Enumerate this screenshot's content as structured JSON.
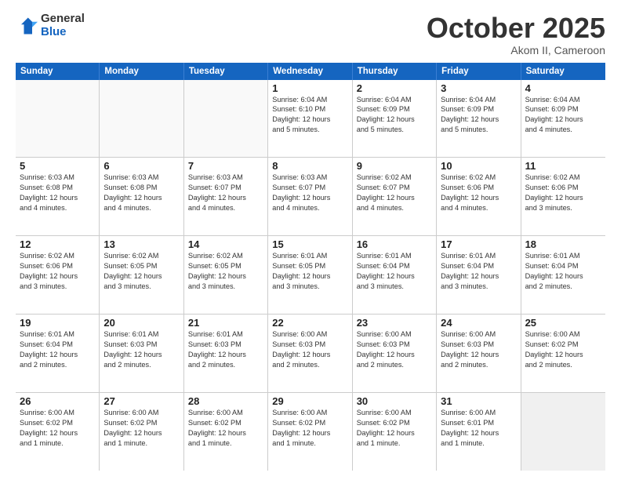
{
  "logo": {
    "general": "General",
    "blue": "Blue"
  },
  "title": "October 2025",
  "subtitle": "Akom II, Cameroon",
  "days": [
    "Sunday",
    "Monday",
    "Tuesday",
    "Wednesday",
    "Thursday",
    "Friday",
    "Saturday"
  ],
  "weeks": [
    [
      {
        "day": "",
        "text": "",
        "empty": true
      },
      {
        "day": "",
        "text": "",
        "empty": true
      },
      {
        "day": "",
        "text": "",
        "empty": true
      },
      {
        "day": "1",
        "text": "Sunrise: 6:04 AM\nSunset: 6:10 PM\nDaylight: 12 hours\nand 5 minutes."
      },
      {
        "day": "2",
        "text": "Sunrise: 6:04 AM\nSunset: 6:09 PM\nDaylight: 12 hours\nand 5 minutes."
      },
      {
        "day": "3",
        "text": "Sunrise: 6:04 AM\nSunset: 6:09 PM\nDaylight: 12 hours\nand 5 minutes."
      },
      {
        "day": "4",
        "text": "Sunrise: 6:04 AM\nSunset: 6:09 PM\nDaylight: 12 hours\nand 4 minutes."
      }
    ],
    [
      {
        "day": "5",
        "text": "Sunrise: 6:03 AM\nSunset: 6:08 PM\nDaylight: 12 hours\nand 4 minutes."
      },
      {
        "day": "6",
        "text": "Sunrise: 6:03 AM\nSunset: 6:08 PM\nDaylight: 12 hours\nand 4 minutes."
      },
      {
        "day": "7",
        "text": "Sunrise: 6:03 AM\nSunset: 6:07 PM\nDaylight: 12 hours\nand 4 minutes."
      },
      {
        "day": "8",
        "text": "Sunrise: 6:03 AM\nSunset: 6:07 PM\nDaylight: 12 hours\nand 4 minutes."
      },
      {
        "day": "9",
        "text": "Sunrise: 6:02 AM\nSunset: 6:07 PM\nDaylight: 12 hours\nand 4 minutes."
      },
      {
        "day": "10",
        "text": "Sunrise: 6:02 AM\nSunset: 6:06 PM\nDaylight: 12 hours\nand 4 minutes."
      },
      {
        "day": "11",
        "text": "Sunrise: 6:02 AM\nSunset: 6:06 PM\nDaylight: 12 hours\nand 3 minutes."
      }
    ],
    [
      {
        "day": "12",
        "text": "Sunrise: 6:02 AM\nSunset: 6:06 PM\nDaylight: 12 hours\nand 3 minutes."
      },
      {
        "day": "13",
        "text": "Sunrise: 6:02 AM\nSunset: 6:05 PM\nDaylight: 12 hours\nand 3 minutes."
      },
      {
        "day": "14",
        "text": "Sunrise: 6:02 AM\nSunset: 6:05 PM\nDaylight: 12 hours\nand 3 minutes."
      },
      {
        "day": "15",
        "text": "Sunrise: 6:01 AM\nSunset: 6:05 PM\nDaylight: 12 hours\nand 3 minutes."
      },
      {
        "day": "16",
        "text": "Sunrise: 6:01 AM\nSunset: 6:04 PM\nDaylight: 12 hours\nand 3 minutes."
      },
      {
        "day": "17",
        "text": "Sunrise: 6:01 AM\nSunset: 6:04 PM\nDaylight: 12 hours\nand 3 minutes."
      },
      {
        "day": "18",
        "text": "Sunrise: 6:01 AM\nSunset: 6:04 PM\nDaylight: 12 hours\nand 2 minutes."
      }
    ],
    [
      {
        "day": "19",
        "text": "Sunrise: 6:01 AM\nSunset: 6:04 PM\nDaylight: 12 hours\nand 2 minutes."
      },
      {
        "day": "20",
        "text": "Sunrise: 6:01 AM\nSunset: 6:03 PM\nDaylight: 12 hours\nand 2 minutes."
      },
      {
        "day": "21",
        "text": "Sunrise: 6:01 AM\nSunset: 6:03 PM\nDaylight: 12 hours\nand 2 minutes."
      },
      {
        "day": "22",
        "text": "Sunrise: 6:00 AM\nSunset: 6:03 PM\nDaylight: 12 hours\nand 2 minutes."
      },
      {
        "day": "23",
        "text": "Sunrise: 6:00 AM\nSunset: 6:03 PM\nDaylight: 12 hours\nand 2 minutes."
      },
      {
        "day": "24",
        "text": "Sunrise: 6:00 AM\nSunset: 6:03 PM\nDaylight: 12 hours\nand 2 minutes."
      },
      {
        "day": "25",
        "text": "Sunrise: 6:00 AM\nSunset: 6:02 PM\nDaylight: 12 hours\nand 2 minutes."
      }
    ],
    [
      {
        "day": "26",
        "text": "Sunrise: 6:00 AM\nSunset: 6:02 PM\nDaylight: 12 hours\nand 1 minute."
      },
      {
        "day": "27",
        "text": "Sunrise: 6:00 AM\nSunset: 6:02 PM\nDaylight: 12 hours\nand 1 minute."
      },
      {
        "day": "28",
        "text": "Sunrise: 6:00 AM\nSunset: 6:02 PM\nDaylight: 12 hours\nand 1 minute."
      },
      {
        "day": "29",
        "text": "Sunrise: 6:00 AM\nSunset: 6:02 PM\nDaylight: 12 hours\nand 1 minute."
      },
      {
        "day": "30",
        "text": "Sunrise: 6:00 AM\nSunset: 6:02 PM\nDaylight: 12 hours\nand 1 minute."
      },
      {
        "day": "31",
        "text": "Sunrise: 6:00 AM\nSunset: 6:01 PM\nDaylight: 12 hours\nand 1 minute."
      },
      {
        "day": "",
        "text": "",
        "empty": true,
        "shaded": true
      }
    ]
  ]
}
